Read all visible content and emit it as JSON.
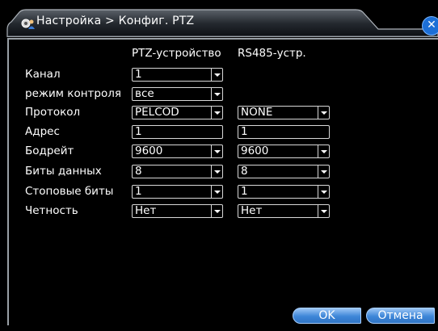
{
  "window": {
    "title": "Настройка > Конфиг. PTZ",
    "title_icon": "gear-user-icon",
    "close_icon": "close-icon",
    "accent_color": "#1d6fd6"
  },
  "columns": {
    "ptz_device": "PTZ-устройство",
    "rs485_device": "RS485-устр."
  },
  "labels": {
    "channel": "Канал",
    "control_mode": "режим контроля",
    "protocol": "Протокол",
    "address": "Адрес",
    "baudrate": "Бодрейт",
    "data_bits": "Биты данных",
    "stop_bits": "Стоповые биты",
    "parity": "Четность"
  },
  "ptz": {
    "channel": "1",
    "control_mode": "все",
    "protocol": "PELCOD",
    "address": "1",
    "baudrate": "9600",
    "data_bits": "8",
    "stop_bits": "1",
    "parity": "Нет"
  },
  "rs485": {
    "protocol": "NONE",
    "address": "1",
    "baudrate": "9600",
    "data_bits": "8",
    "stop_bits": "1",
    "parity": "Нет"
  },
  "buttons": {
    "ok": "OK",
    "cancel": "Отмена"
  }
}
